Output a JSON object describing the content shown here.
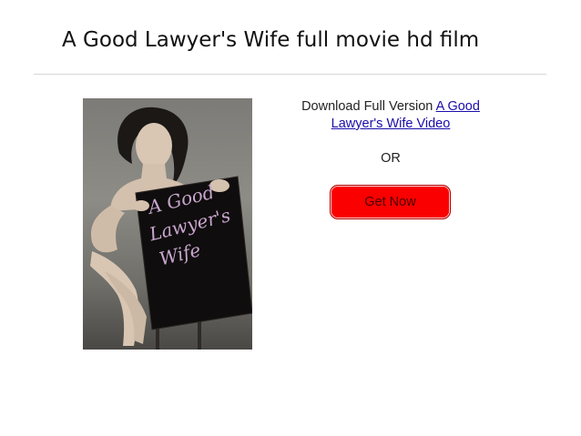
{
  "page": {
    "title": "A Good Lawyer's Wife full movie hd film"
  },
  "poster": {
    "title_line1": "A Good",
    "title_line2": "Lawyer's",
    "title_line3": "Wife"
  },
  "download": {
    "prefix": "Download Full Version ",
    "link_text": "A Good Lawyer's Wife Video"
  },
  "separator": {
    "text": "OR"
  },
  "cta": {
    "label": "Get Now"
  },
  "colors": {
    "button_bg": "#fa0000",
    "link": "#1a0dab",
    "poster_title": "#c9a6cf"
  }
}
